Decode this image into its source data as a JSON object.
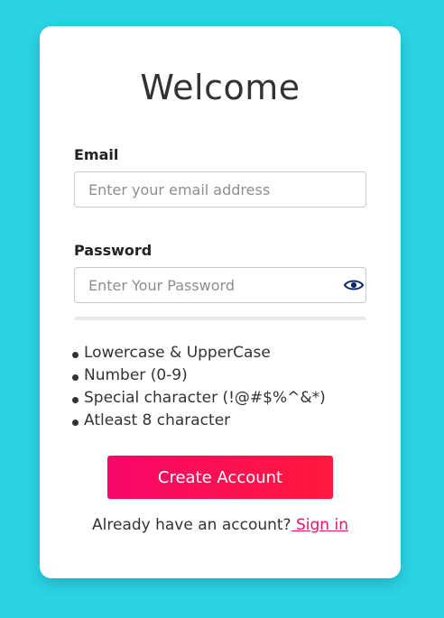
{
  "colors": {
    "page_bg": "#2ad4e5",
    "card_bg": "#ffffff",
    "accent_start": "#f6076a",
    "accent_end": "#ff1a3c",
    "link": "#e6136c",
    "eye_icon": "#0b2a6b"
  },
  "form": {
    "title": "Welcome",
    "email": {
      "label": "Email",
      "value": "",
      "placeholder": "Enter your email address"
    },
    "password": {
      "label": "Password",
      "value": "",
      "placeholder": "Enter Your Password",
      "toggle_icon": "eye-icon",
      "strength_fraction": 0
    },
    "rules": [
      "Lowercase & UpperCase",
      "Number (0-9)",
      "Special character (!@#$%^&*)",
      "Atleast 8 character"
    ],
    "submit_label": "Create Account",
    "signin_prompt": "Already have an account?",
    "signin_link": " Sign in"
  }
}
